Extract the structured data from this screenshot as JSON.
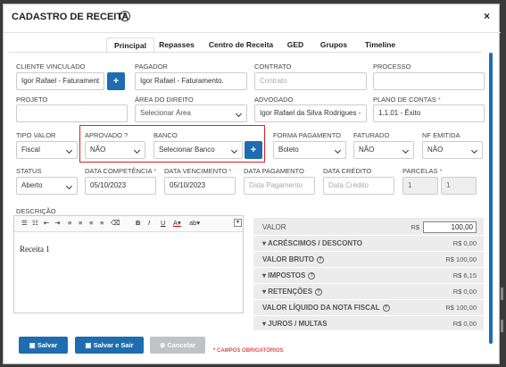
{
  "modal": {
    "title": "CADASTRO DE RECEITA",
    "help_icon": "?",
    "close_icon": "×"
  },
  "tabs": [
    "Principal",
    "Repasses",
    "Centro de Receita",
    "GED",
    "Grupos",
    "Timeline"
  ],
  "fields": {
    "cliente_vinculado": {
      "label": "CLIENTE VINCULADO",
      "value": "Igor Rafael - Faturament"
    },
    "pagador": {
      "label": "PAGADOR",
      "value": "Igor Rafael - Faturamento."
    },
    "contrato": {
      "label": "CONTRATO",
      "placeholder": "Contrato"
    },
    "processo": {
      "label": "PROCESSO",
      "value": ""
    },
    "projeto": {
      "label": "PROJETO",
      "value": ""
    },
    "area_direito": {
      "label": "ÁREA DO DIREITO",
      "value": "Selecionar Área"
    },
    "advogado": {
      "label": "ADVOGADO",
      "value": "Igor Rafael da Silva Rodrigues -"
    },
    "plano_contas": {
      "label": "PLANO DE CONTAS",
      "req": "*",
      "value": "1.1.01 - Êxito"
    },
    "tipo_valor": {
      "label": "TIPO VALOR",
      "value": "Fiscal"
    },
    "aprovado": {
      "label": "APROVADO ?",
      "value": "NÃO"
    },
    "banco": {
      "label": "BANCO",
      "value": "Selecionar Banco"
    },
    "forma_pagamento": {
      "label": "FORMA PAGAMENTO",
      "value": "Boleto"
    },
    "faturado": {
      "label": "FATURADO",
      "value": "NÃO"
    },
    "nf_emitida": {
      "label": "NF EMITIDA",
      "value": "NÃO"
    },
    "status": {
      "label": "STATUS",
      "value": "Aberto"
    },
    "data_competencia": {
      "label": "DATA COMPETÊNCIA",
      "req": "*",
      "value": "05/10/2023"
    },
    "data_vencimento": {
      "label": "DATA VENCIMENTO",
      "req": "*",
      "value": "05/10/2023"
    },
    "data_pagamento": {
      "label": "DATA PAGAMENTO",
      "placeholder": "Data Pagamento"
    },
    "data_credito": {
      "label": "DATA CRÉDITO",
      "placeholder": "Data Crédito"
    },
    "parcelas": {
      "label": "PARCELAS",
      "req": "*",
      "value1": "1",
      "value2": "1"
    }
  },
  "descricao": {
    "label": "DESCRIÇÃO",
    "text": "Receita 1"
  },
  "summary": {
    "valor": {
      "label": "VALOR",
      "currency": "R$",
      "value": "100,00"
    },
    "rows": [
      {
        "label": "▾ ACRÉSCIMOS / DESCONTO",
        "value": "R$ 0,00"
      },
      {
        "label": "VALOR BRUTO",
        "value": "R$ 100,00",
        "hint": "?"
      },
      {
        "label": "▾ IMPOSTOS",
        "value": "R$ 6,15",
        "hint": "?"
      },
      {
        "label": "▾ RETENÇÕES",
        "value": "R$ 0,00",
        "hint": "?"
      },
      {
        "label": "VALOR LÍQUIDO DA NOTA FISCAL",
        "value": "R$ 100,00",
        "hint": "?"
      },
      {
        "label": "▾ JUROS / MULTAS",
        "value": "R$ 0,00"
      }
    ]
  },
  "buttons": {
    "salvar": "Salvar",
    "salvar_sair": "Salvar e Sair",
    "cancelar": "Cancelar"
  },
  "required_note": "* CAMPOS OBRIGATÓRIOS"
}
